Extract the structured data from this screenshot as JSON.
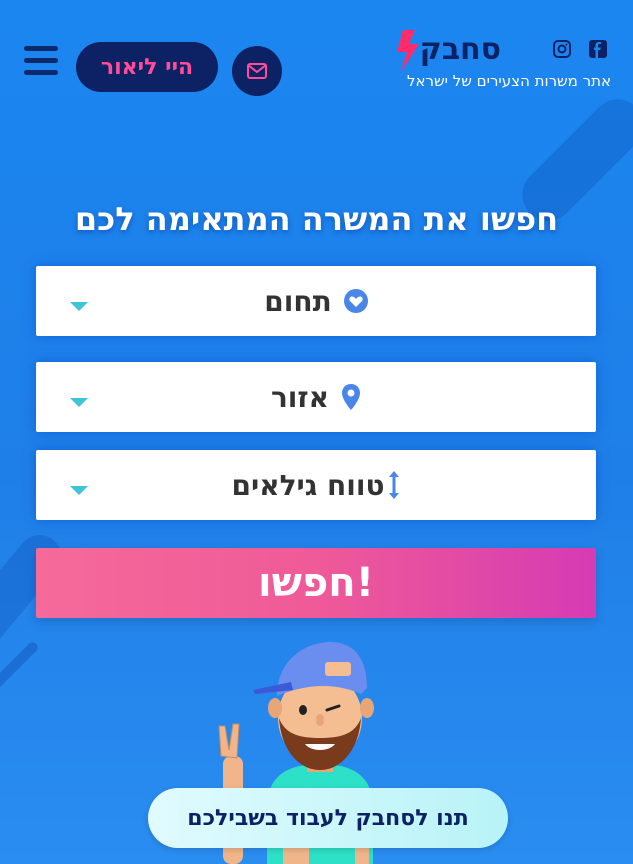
{
  "header": {
    "logo_text": "סחבק",
    "tagline": "אתר משרות הצעירים של ישראל",
    "hi_button_label": "היי ליאור"
  },
  "main": {
    "headline": "חפשו את המשרה המתאימה לכם",
    "fields": [
      {
        "label": "תחום",
        "icon": "heart-icon"
      },
      {
        "label": "אזור",
        "icon": "location-pin-icon"
      },
      {
        "label": "טווח גילאים",
        "icon": "vertical-arrows-icon"
      }
    ],
    "search_button_label": "חפשו!"
  },
  "cta": {
    "label": "תנו לסחבק לעבוד בשבילכם"
  },
  "colors": {
    "background": "#1b86f0",
    "navy": "#0c2264",
    "pink": "#ff4d9a",
    "accent_cyan": "#3fc3d6"
  }
}
